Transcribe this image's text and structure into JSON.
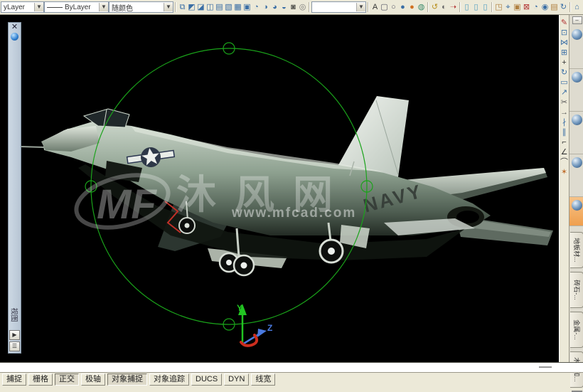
{
  "colors": {
    "orbit_green": "#1aa31a",
    "axis_y": "#22c522",
    "axis_z": "#4a7ae0",
    "axis_x": "#cc2e1e",
    "watermark_white": "#ffffff",
    "active_cell_orange": "#ef9f4e"
  },
  "top_toolbar": {
    "combos": [
      {
        "name": "layer-color-combo",
        "value": "yLayer"
      },
      {
        "name": "linetype-combo",
        "value": "ByLayer"
      },
      {
        "name": "plotstyle-combo",
        "value": "随颜色"
      },
      {
        "name": "view-combo",
        "value": ""
      }
    ],
    "arrow_glyph": "▼",
    "group_views": [
      {
        "name": "named-views-icon",
        "glyph": "⧉",
        "color": "#3a6ea5"
      },
      {
        "name": "view-cube-top-icon",
        "glyph": "◩",
        "color": "#3a6ea5"
      },
      {
        "name": "view-cube-bottom-icon",
        "glyph": "◪",
        "color": "#3a6ea5"
      },
      {
        "name": "view-cube-left-icon",
        "glyph": "◫",
        "color": "#3a6ea5"
      },
      {
        "name": "view-cube-right-icon",
        "glyph": "▤",
        "color": "#3a6ea5"
      },
      {
        "name": "view-cube-front-icon",
        "glyph": "▧",
        "color": "#3a6ea5"
      },
      {
        "name": "view-cube-back-icon",
        "glyph": "▦",
        "color": "#3a6ea5"
      },
      {
        "name": "view-cube-iso-icon",
        "glyph": "▣",
        "color": "#3a6ea5"
      },
      {
        "name": "orbit-sw-icon",
        "glyph": "◔",
        "color": "#3a6ea5"
      },
      {
        "name": "orbit-se-icon",
        "glyph": "◑",
        "color": "#3a6ea5"
      },
      {
        "name": "orbit-ne-icon",
        "glyph": "◕",
        "color": "#3a6ea5"
      },
      {
        "name": "orbit-nw-icon",
        "glyph": "◒",
        "color": "#3a6ea5"
      },
      {
        "name": "camera-icon",
        "glyph": "◙",
        "color": "#555550"
      },
      {
        "name": "target-compass-icon",
        "glyph": "◎",
        "color": "#777"
      }
    ],
    "group_styles": [
      {
        "name": "text-style-icon",
        "glyph": "A",
        "color": "#333"
      },
      {
        "name": "wireframe-2d-icon",
        "glyph": "▢",
        "color": "#556"
      },
      {
        "name": "wireframe-3d-icon",
        "glyph": "○",
        "color": "#556"
      },
      {
        "name": "realistic-style-icon",
        "glyph": "●",
        "color": "#3a6ea5"
      },
      {
        "name": "conceptual-style-icon",
        "glyph": "●",
        "color": "#d07020"
      },
      {
        "name": "materials-icon",
        "glyph": "◍",
        "color": "#3a8a6a"
      }
    ],
    "group_render": [
      {
        "name": "render-sweep-icon",
        "glyph": "↺",
        "color": "#b89020"
      },
      {
        "name": "render-region-icon",
        "glyph": "◐",
        "color": "#666"
      },
      {
        "name": "render-icon",
        "glyph": "➝",
        "color": "#b03030"
      }
    ],
    "group_lights": [
      {
        "name": "point-light-icon",
        "glyph": "▯",
        "color": "#4a9ac0"
      },
      {
        "name": "spot-light-icon",
        "glyph": "▯",
        "color": "#4a9ac0"
      },
      {
        "name": "distant-light-icon",
        "glyph": "▯",
        "color": "#4a9ac0"
      }
    ],
    "group_modeling": [
      {
        "name": "box-solid-icon",
        "glyph": "◳",
        "color": "#b08040"
      },
      {
        "name": "polysolid-icon",
        "glyph": "⌖",
        "color": "#3a6ea5"
      },
      {
        "name": "cube-solid-icon",
        "glyph": "▣",
        "color": "#b08040"
      },
      {
        "name": "wedge-icon",
        "glyph": "⊠",
        "color": "#b03030"
      },
      {
        "name": "cylinder-icon",
        "glyph": "◔",
        "color": "#3a6ea5"
      },
      {
        "name": "sphere-solid-icon",
        "glyph": "◉",
        "color": "#3a6ea5"
      },
      {
        "name": "extrude-icon",
        "glyph": "▤",
        "color": "#b08040"
      },
      {
        "name": "revolve-icon",
        "glyph": "↻",
        "color": "#3a6ea5"
      }
    ],
    "group_misc": [
      {
        "name": "union-icon",
        "glyph": "⌂",
        "color": "#3a6ea5"
      },
      {
        "name": "subtract-icon",
        "glyph": "▥",
        "color": "#3a6ea5"
      },
      {
        "name": "partial-icon-1",
        "glyph": "◆",
        "color": "#c04040"
      },
      {
        "name": "partial-icon-2",
        "glyph": "▨",
        "color": "#c8a060"
      }
    ]
  },
  "left_strip": {
    "close_glyph": "✕",
    "label": "视图",
    "play_glyph": "▶",
    "list_glyph": "☰"
  },
  "modify_toolbar": [
    {
      "name": "erase-icon",
      "glyph": "✎",
      "color": "#b03030"
    },
    {
      "name": "copy-icon",
      "glyph": "⊡",
      "color": "#3a6ea5"
    },
    {
      "name": "mirror-icon",
      "glyph": "⋈",
      "color": "#3a6ea5"
    },
    {
      "name": "array-icon",
      "glyph": "⊞",
      "color": "#3a6ea5"
    },
    {
      "name": "move-icon",
      "glyph": "+",
      "color": "#333"
    },
    {
      "name": "rotate-icon",
      "glyph": "↻",
      "color": "#3a6ea5"
    },
    {
      "name": "scale-icon",
      "glyph": "▭",
      "color": "#3a6ea5"
    },
    {
      "name": "stretch-icon",
      "glyph": "↗",
      "color": "#3a6ea5"
    },
    {
      "name": "trim-icon",
      "glyph": "✂",
      "color": "#555"
    },
    {
      "name": "extend-icon",
      "glyph": "→",
      "color": "#555"
    },
    {
      "name": "break-point-icon",
      "glyph": "∤",
      "color": "#3a6ea5"
    },
    {
      "name": "break-icon",
      "glyph": "∥",
      "color": "#3a6ea5"
    },
    {
      "name": "join-icon",
      "glyph": "⌐",
      "color": "#333"
    },
    {
      "name": "chamfer-icon",
      "glyph": "∠",
      "color": "#333"
    },
    {
      "name": "fillet-icon",
      "glyph": "⌒",
      "color": "#333"
    },
    {
      "name": "explode-icon",
      "glyph": "✶",
      "color": "#c07030"
    }
  ],
  "palette": {
    "minimize_glyph": "–",
    "samples": [
      {
        "name": "material-sample-1",
        "active": false
      },
      {
        "name": "material-sample-2",
        "active": false
      },
      {
        "name": "material-sample-3",
        "active": false
      },
      {
        "name": "material-sample-4",
        "active": false
      },
      {
        "name": "material-sample-5",
        "active": true
      }
    ],
    "tabs": [
      {
        "name": "tab-floor-materials",
        "label": "地板材..."
      },
      {
        "name": "tab-masonry-materials",
        "label": "砖石-..."
      },
      {
        "name": "tab-metal-materials",
        "label": "金属-..."
      },
      {
        "name": "tab-wood-materials",
        "label": "木材和..."
      }
    ]
  },
  "viewport": {
    "watermark": {
      "logo": "MF",
      "text": "沐风网",
      "url": "www.mfcad.com"
    },
    "fuselage_text": "NAVY",
    "axis_labels": {
      "y": "Y",
      "z": "Z"
    }
  },
  "command_line": {
    "value": ""
  },
  "status_bar": {
    "buttons": [
      {
        "name": "snap-toggle",
        "label": "捕捉",
        "active": false
      },
      {
        "name": "grid-toggle",
        "label": "栅格",
        "active": false
      },
      {
        "name": "ortho-toggle",
        "label": "正交",
        "active": true
      },
      {
        "name": "polar-toggle",
        "label": "极轴",
        "active": false
      },
      {
        "name": "osnap-toggle",
        "label": "对象捕捉",
        "active": true
      },
      {
        "name": "otrack-toggle",
        "label": "对象追踪",
        "active": false
      },
      {
        "name": "ducs-toggle",
        "label": "DUCS",
        "active": false
      },
      {
        "name": "dyn-toggle",
        "label": "DYN",
        "active": false
      },
      {
        "name": "lineweight-toggle",
        "label": "线宽",
        "active": false
      }
    ]
  }
}
